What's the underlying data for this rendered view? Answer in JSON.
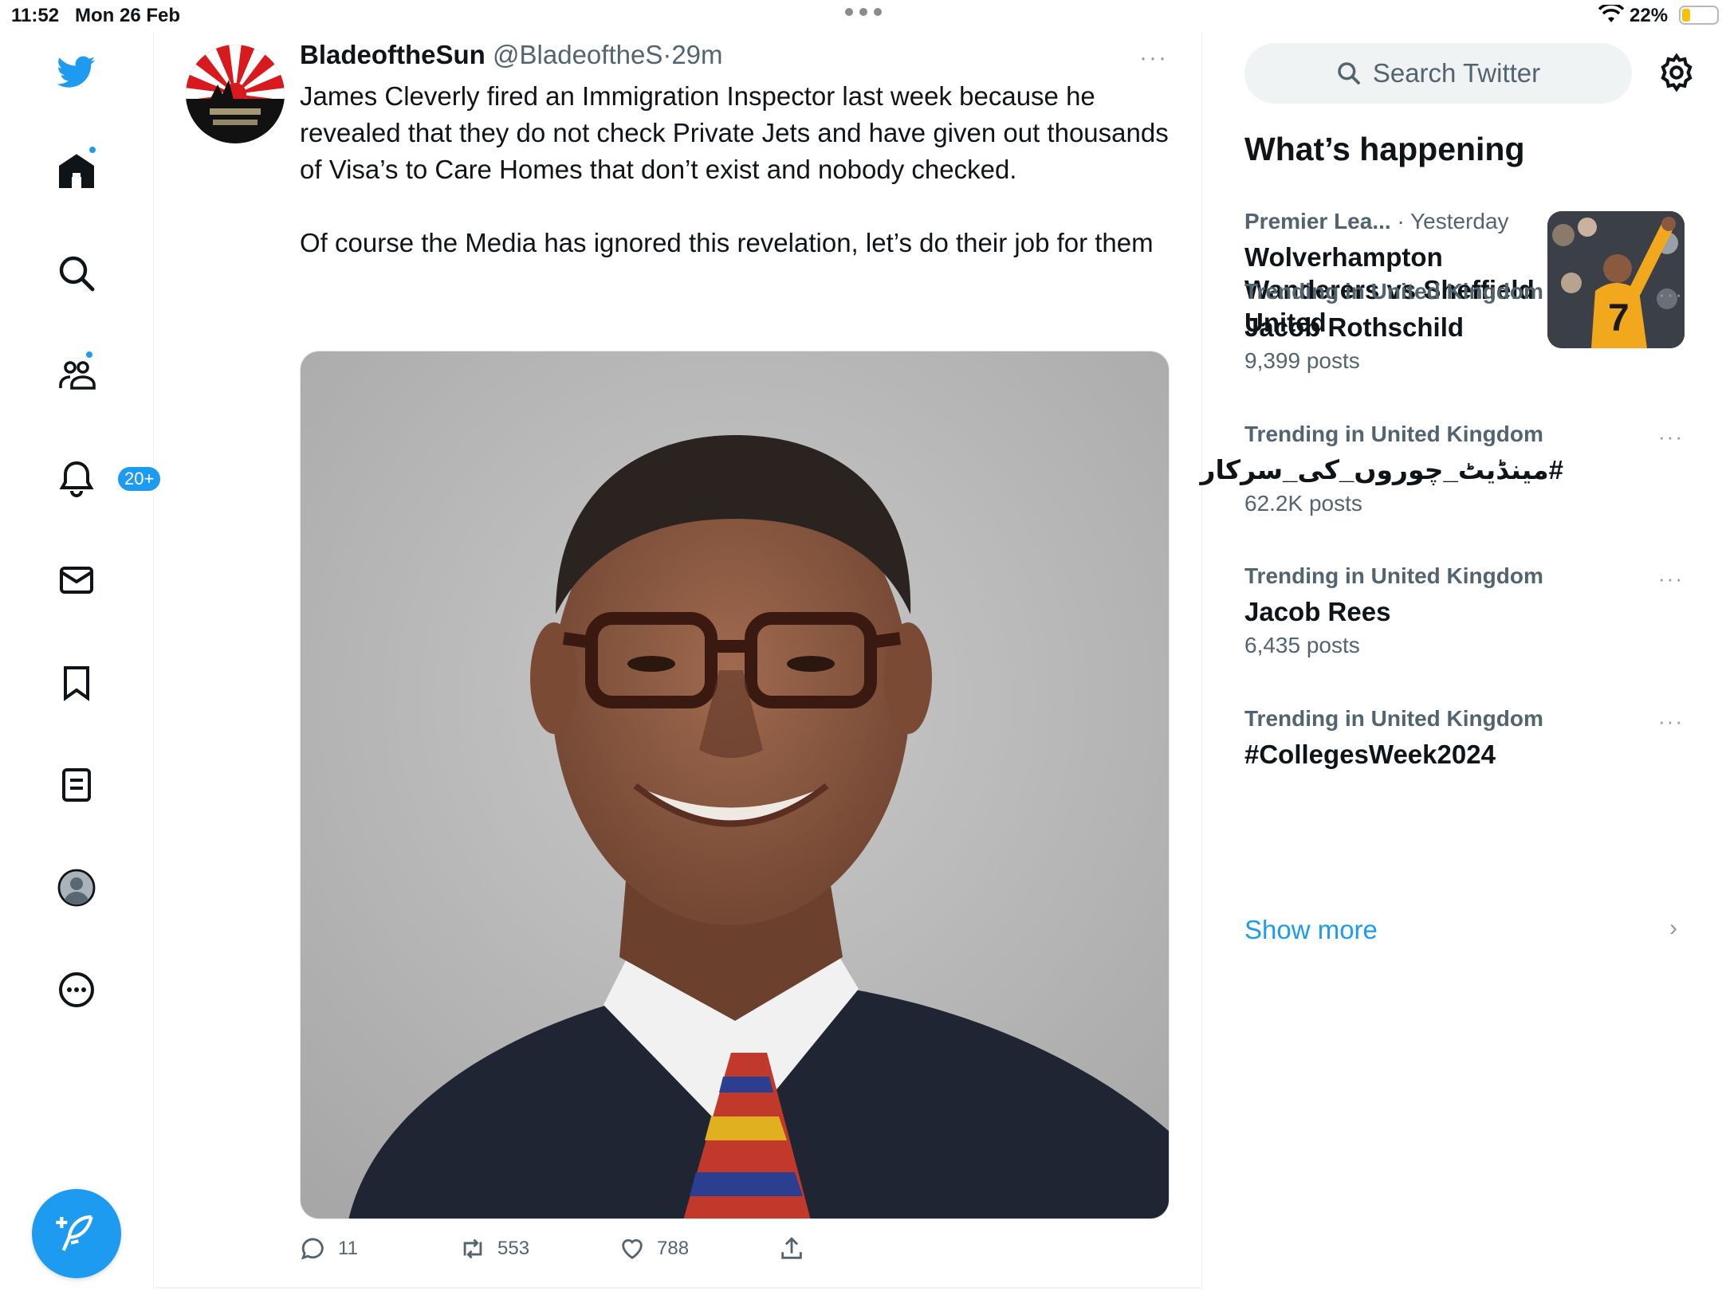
{
  "status_bar": {
    "time": "11:52",
    "date": "Mon 26 Feb",
    "battery_pct": "22%"
  },
  "nav": {
    "icons": [
      "twitter-bird-icon",
      "home-icon",
      "search-icon",
      "communities-icon",
      "notifications-icon",
      "messages-icon",
      "bookmarks-icon",
      "lists-icon",
      "profile-icon",
      "more-icon"
    ],
    "notifications_badge": "20+",
    "compose_icon": "compose-feather-icon"
  },
  "tweet": {
    "display_name": "BladeoftheSun",
    "handle": "@BladeoftheS",
    "separator": "·",
    "time": "29m",
    "more": "···",
    "text": "James Cleverly fired an Immigration Inspector last week because he revealed that they do not check Private Jets and have given out thousands of Visa’s to Care Homes that don’t exist and nobody checked.\n\nOf course the Media has ignored this revelation, let’s do their job for them",
    "actions": {
      "replies": "11",
      "retweets": "553",
      "likes": "788"
    }
  },
  "sidebar": {
    "search_placeholder": "Search Twitter",
    "heading": "What’s happening",
    "featured": {
      "category": "Premier Lea...",
      "time": "· Yesterday",
      "title": "Wolverhampton Wanderers vs Sheffield United"
    },
    "trends": [
      {
        "context": "Trending in United Kingdom",
        "title": "Jacob Rothschild",
        "count": "9,399 posts",
        "more": "···"
      },
      {
        "context": "Trending in United Kingdom",
        "title": "#مینڈیٹ_چوروں_کی_سرکار",
        "count": "62.2K posts",
        "more": "···"
      },
      {
        "context": "Trending in United Kingdom",
        "title": "Jacob Rees",
        "count": "6,435 posts",
        "more": "···"
      },
      {
        "context": "Trending in United Kingdom",
        "title": "#CollegesWeek2024",
        "count": "",
        "more": "···"
      }
    ],
    "show_more": "Show more",
    "show_more_chevron": "›"
  },
  "colors": {
    "accent": "#1d9bf0",
    "text_primary": "#0f1419",
    "text_secondary": "#536471"
  }
}
